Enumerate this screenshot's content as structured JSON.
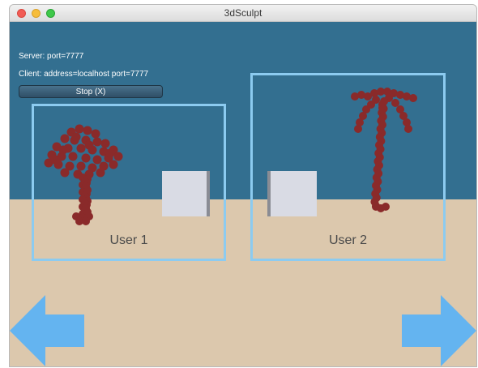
{
  "window": {
    "title": "3dSculpt"
  },
  "network": {
    "server_status": "Server: port=7777",
    "client_status": "Client: address=localhost port=7777",
    "stop_button_label": "Stop (X)"
  },
  "users": [
    {
      "label": "User 1"
    },
    {
      "label": "User 2"
    }
  ],
  "navigation": {
    "previous_icon": "left-arrow-icon",
    "next_icon": "right-arrow-icon"
  },
  "colors": {
    "sky": "#336f90",
    "ground": "#dcc8ad",
    "frame": "#8ccbf0",
    "sculpture": "#8a2a2a",
    "arrow": "#64b4f0"
  }
}
